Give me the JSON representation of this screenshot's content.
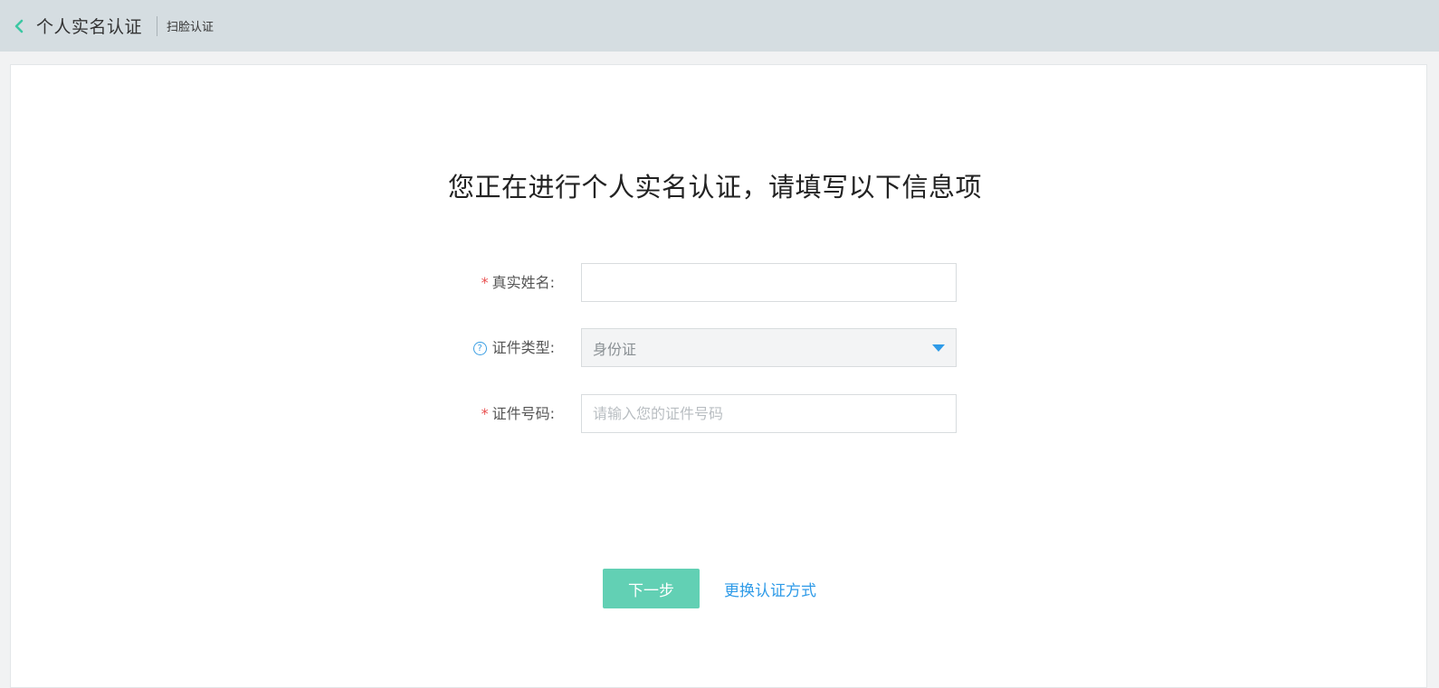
{
  "header": {
    "back_icon": "chevron-left-icon",
    "title": "个人实名认证",
    "subtitle": "扫脸认证",
    "accent_color": "#3cc7a3"
  },
  "main": {
    "title": "您正在进行个人实名认证，请填写以下信息项",
    "form": {
      "name": {
        "required_mark": "*",
        "label": "真实姓名:",
        "value": ""
      },
      "id_type": {
        "help_icon": "question-circle-icon",
        "help_glyph": "?",
        "label": "证件类型:",
        "value": "身份证",
        "dropdown_icon": "caret-down-icon"
      },
      "id_number": {
        "required_mark": "*",
        "label": "证件号码:",
        "placeholder": "请输入您的证件号码",
        "value": ""
      }
    },
    "actions": {
      "next_label": "下一步",
      "switch_label": "更换认证方式"
    }
  },
  "colors": {
    "header_bg": "#d5dde1",
    "primary_button": "#62d0b4",
    "link": "#2f9be8",
    "required": "#e94f4f"
  }
}
